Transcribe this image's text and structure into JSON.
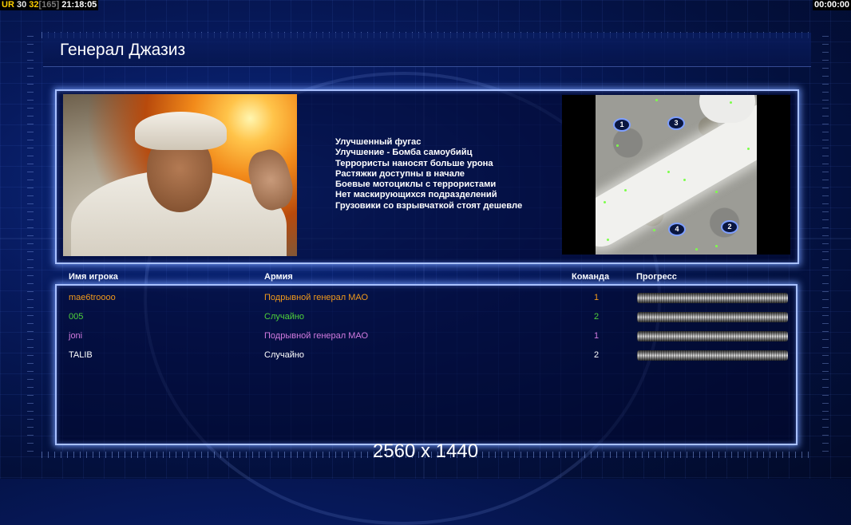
{
  "hud": {
    "left_ur": "UR",
    "left_a": "30",
    "left_b": "32",
    "left_c": "[165]",
    "left_time": "21:18:05",
    "right_timer": "00:00:00"
  },
  "title": "Генерал Джазиз",
  "bonuses": [
    "Улучшенный фугас",
    "Улучшение - Бомба самоубийц",
    "Террористы наносят больше урона",
    "Растяжки доступны в начале",
    "Боевые мотоциклы с террористами",
    "Нет маскирующихся подразделений",
    "Грузовики со взрывчаткой стоят дешевле"
  ],
  "map": {
    "start_positions": [
      "1",
      "3",
      "4",
      "2"
    ]
  },
  "table": {
    "headers": {
      "name": "Имя игрока",
      "army": "Армия",
      "team": "Команда",
      "progress": "Прогресс"
    },
    "players": [
      {
        "name": "mae6troooo",
        "army": "Подрывной генерал МАО",
        "team": "1",
        "color": "#f29a1a",
        "progress": 1.0
      },
      {
        "name": "005",
        "army": "Случайно",
        "team": "2",
        "color": "#4fd23a",
        "progress": 1.0
      },
      {
        "name": "joni",
        "army": "Подрывной генерал МАО",
        "team": "1",
        "color": "#d27be0",
        "progress": 1.0
      },
      {
        "name": "TALIB",
        "army": "Случайно",
        "team": "2",
        "color": "#ffffff",
        "progress": 1.0
      }
    ]
  },
  "resolution": "2560 x 1440"
}
